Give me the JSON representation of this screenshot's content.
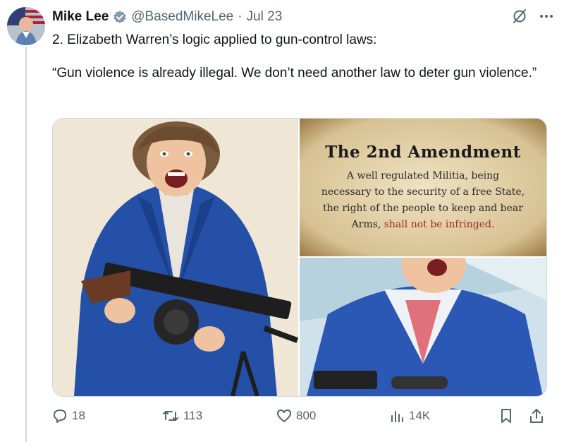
{
  "tweet": {
    "author_name": "Mike Lee",
    "handle": "@BasedMikeLee",
    "separator": "·",
    "date": "Jul 23",
    "lines": [
      "2. Elizabeth Warren’s logic applied to gun-control laws:",
      "“Gun violence is already illegal. We don’t need another law to deter gun violence.”"
    ]
  },
  "images": {
    "amendment": {
      "title": "The 2nd Amendment",
      "lines": [
        "A well regulated Militia, being",
        "necessary to the security of a free State,",
        "the right of the people to keep and bear"
      ],
      "last_line_start": "Arms, ",
      "last_line_emphasis": "shall not be infringed."
    }
  },
  "actions": {
    "replies": "18",
    "reposts": "113",
    "likes": "800",
    "views": "14K"
  },
  "colors": {
    "text": "#0f1419",
    "secondary": "#536471",
    "verified": "#829aab",
    "border": "#cfd9de"
  },
  "icons": [
    "verified-badge-icon",
    "grok-icon",
    "more-icon",
    "reply-icon",
    "repost-icon",
    "like-icon",
    "views-icon",
    "bookmark-icon",
    "share-icon"
  ]
}
